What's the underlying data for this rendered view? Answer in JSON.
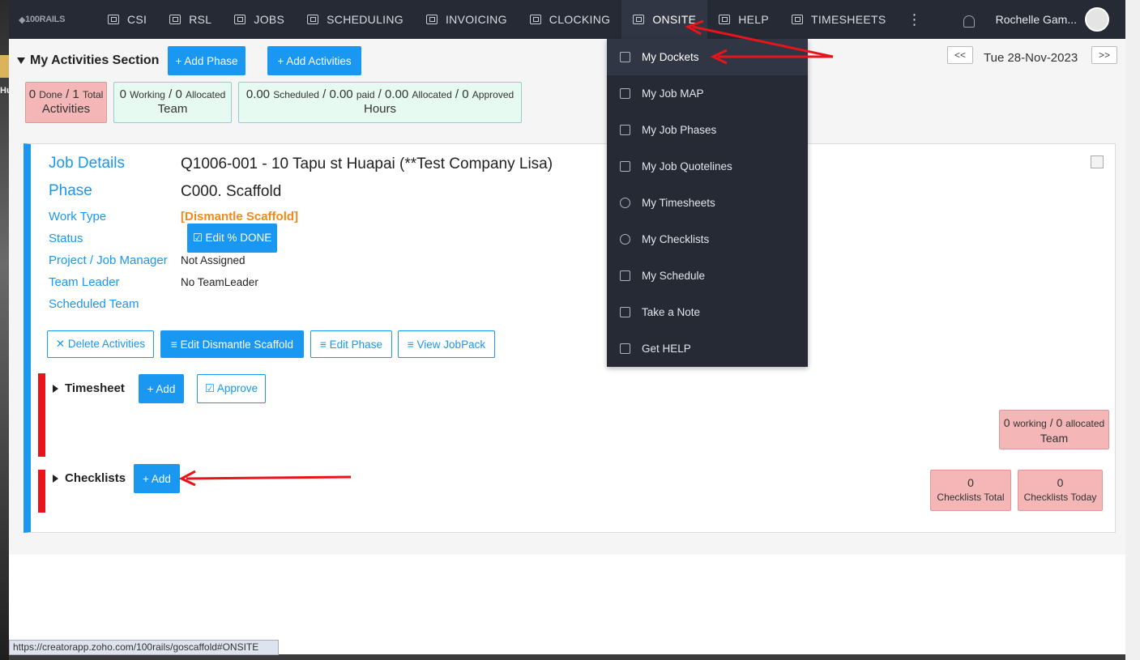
{
  "nav": {
    "logo": "100RAILS",
    "items": [
      {
        "label": "CSI"
      },
      {
        "label": "RSL"
      },
      {
        "label": "JOBS"
      },
      {
        "label": "SCHEDULING"
      },
      {
        "label": "INVOICING"
      },
      {
        "label": "CLOCKING"
      },
      {
        "label": "ONSITE"
      },
      {
        "label": "HELP"
      },
      {
        "label": "TIMESHEETS"
      }
    ],
    "more": "⋮",
    "user_name": "Rochelle Gam..."
  },
  "section": {
    "title": "My Activities Section",
    "add_phase": "+ Add Phase",
    "add_activities": "+ Add Activities",
    "date_prev": "<<",
    "date_next": ">>",
    "date": "Tue 28-Nov-2023"
  },
  "stats": {
    "activities": {
      "done": "0",
      "done_label": "Done",
      "total": "1",
      "total_label": "Total",
      "caption": "Activities"
    },
    "team": {
      "working": "0",
      "working_label": "Working",
      "allocated": "0",
      "allocated_label": "Allocated",
      "caption": "Team"
    },
    "hours": {
      "scheduled": "0.00",
      "scheduled_label": "Scheduled",
      "paid": "0.00",
      "paid_label": "paid",
      "allocated": "0.00",
      "allocated_label": "Allocated",
      "approved": "0",
      "approved_label": "Approved",
      "caption": "Hours"
    }
  },
  "job": {
    "job_details_label": "Job Details",
    "job_details_value": "Q1006-001 - 10 Tapu st Huapai (**Test Company Lisa)",
    "phase_label": "Phase",
    "phase_value": "C000. Scaffold",
    "work_type_label": "Work Type",
    "work_type_value": "[Dismantle Scaffold]",
    "status_label": "Status",
    "edit_done_button": "☑ Edit % DONE",
    "manager_label": "Project / Job Manager",
    "manager_value": "Not Assigned",
    "team_leader_label": "Team Leader",
    "team_leader_value": "No TeamLeader",
    "scheduled_team_label": "Scheduled Team",
    "delete_activities": "✕ Delete Activities",
    "edit_dismantle": "≡ Edit Dismantle Scaffold",
    "edit_phase": "≡ Edit Phase",
    "view_jobpack": "≡ View JobPack"
  },
  "timesheet": {
    "title": "Timesheet",
    "add": "+ Add",
    "approve": "☑ Approve",
    "team_working": "0",
    "team_working_label": "working",
    "team_allocated": "0",
    "team_allocated_label": "allocated",
    "team_caption": "Team"
  },
  "checklists": {
    "title": "Checklists",
    "add": "+ Add",
    "total_value": "0",
    "total_label": "Checklists Total",
    "today_value": "0",
    "today_label": "Checklists Today"
  },
  "dropdown": {
    "items": [
      {
        "label": "My Dockets"
      },
      {
        "label": "My Job MAP"
      },
      {
        "label": "My Job Phases"
      },
      {
        "label": "My Job Quotelines"
      },
      {
        "label": "My Timesheets"
      },
      {
        "label": "My Checklists"
      },
      {
        "label": "My Schedule"
      },
      {
        "label": "Take a Note"
      },
      {
        "label": "Get HELP"
      }
    ]
  },
  "status_url": "https://creatorapp.zoho.com/100rails/goscaffold#ONSITE",
  "colors": {
    "accent": "#1a97f0",
    "nav_bg": "#252a35",
    "alert_red": "#e8141b",
    "orange": "#f28a1a"
  }
}
